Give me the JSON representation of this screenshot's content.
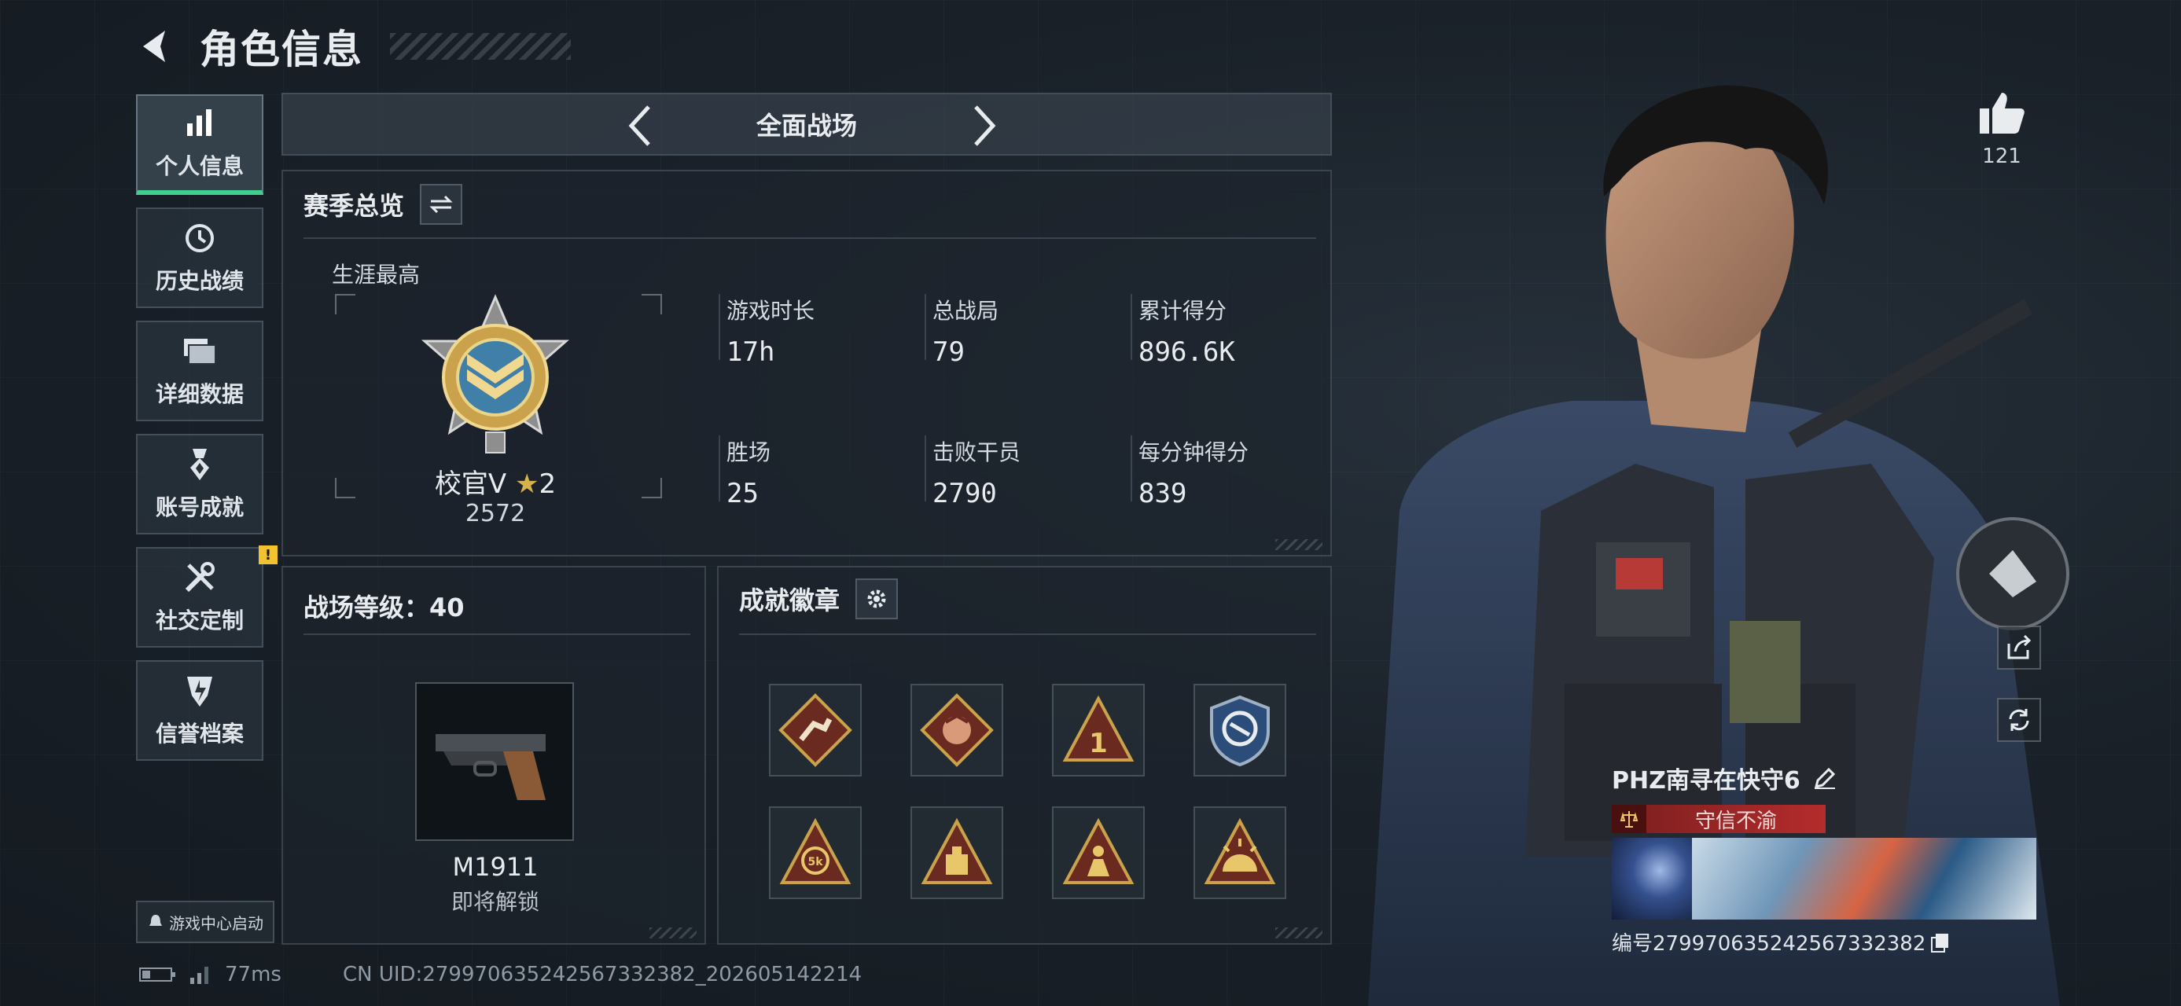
{
  "header": {
    "title": "角色信息"
  },
  "sidebar": {
    "items": [
      {
        "label": "个人信息",
        "icon": "bar-chart-icon",
        "active": true
      },
      {
        "label": "历史战绩",
        "icon": "history-clock-icon"
      },
      {
        "label": "详细数据",
        "icon": "folder-stack-icon"
      },
      {
        "label": "账号成就",
        "icon": "achievement-medal-icon"
      },
      {
        "label": "社交定制",
        "icon": "tools-icon",
        "badge": "!"
      },
      {
        "label": "信誉档案",
        "icon": "credit-shield-icon"
      }
    ],
    "game_center_label": "游戏中心启动"
  },
  "mode": {
    "title": "全面战场"
  },
  "season": {
    "title": "赛季总览",
    "career_label": "生涯最高",
    "rank_name": "校官V",
    "rank_stars": "2",
    "rank_points": "2572",
    "stats": [
      {
        "label": "游戏时长",
        "value": "17h"
      },
      {
        "label": "总战局",
        "value": "79"
      },
      {
        "label": "累计得分",
        "value": "896.6K"
      },
      {
        "label": "胜场",
        "value": "25"
      },
      {
        "label": "击败干员",
        "value": "2790"
      },
      {
        "label": "每分钟得分",
        "value": "839"
      }
    ]
  },
  "level": {
    "title": "战场等级：40",
    "weapon_name": "M1911",
    "weapon_status": "即将解锁"
  },
  "badges": {
    "title": "成就徽章",
    "items": [
      "badge-runner-diamond",
      "badge-dragon-diamond",
      "badge-rank1-triangle",
      "badge-shield-emblem",
      "badge-5k-triangle",
      "badge-vault-triangle",
      "badge-figure-triangle",
      "badge-sunrise-triangle"
    ]
  },
  "status": {
    "ping": "77ms",
    "uid": "CN UID:279970635242567332382_202605142214"
  },
  "likes": {
    "count": "121"
  },
  "player": {
    "name": "PHZ南寻在快守6",
    "credit": "守信不渝",
    "id_text": "编号279970635242567332382"
  },
  "colors": {
    "accent": "#3fcf8e",
    "warning": "#f2c230",
    "credit_red": "#b52c2c",
    "gold": "#c9a24b"
  }
}
